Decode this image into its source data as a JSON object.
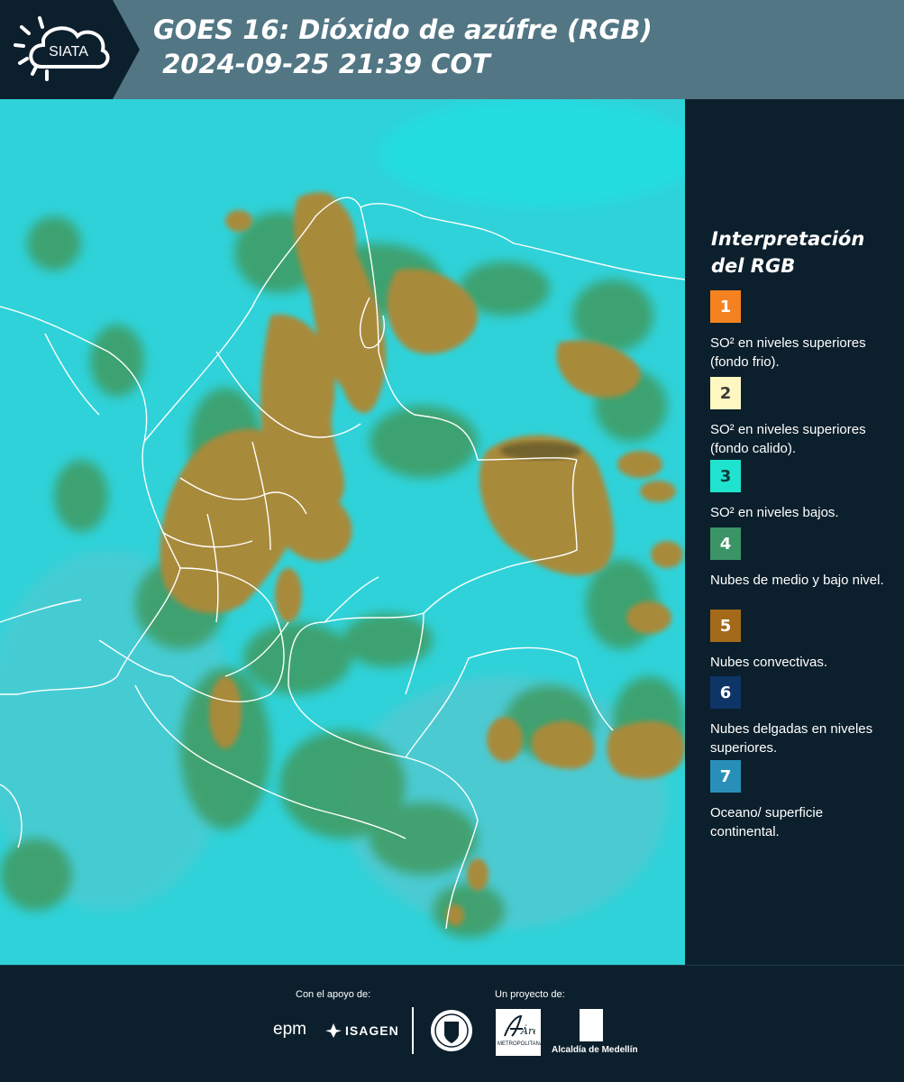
{
  "header": {
    "logo_text": "SIATA",
    "title_line1": "GOES 16: Dióxido de azúfre (RGB)",
    "title_line2": " 2024-09-25 21:39 COT",
    "background_color": "#527684"
  },
  "legend": {
    "title_line1": "Interpretación",
    "title_line2": "del RGB",
    "items": [
      {
        "number": "1",
        "color": "#f58220",
        "text_color": "#ffffff",
        "label": "SO² en niveles superiores (fondo frio)."
      },
      {
        "number": "2",
        "color": "#fff7c2",
        "text_color": "#3a3a3a",
        "label": "SO² en niveles superiores (fondo calido)."
      },
      {
        "number": "3",
        "color": "#1fe3cf",
        "text_color": "#0c3a3a",
        "label": "SO² en niveles bajos."
      },
      {
        "number": "4",
        "color": "#3a9466",
        "text_color": "#ffffff",
        "label": "Nubes de medio y bajo nivel."
      },
      {
        "number": "5",
        "color": "#a36a1a",
        "text_color": "#ffffff",
        "label": "Nubes convectivas."
      },
      {
        "number": "6",
        "color": "#0d3566",
        "text_color": "#ffffff",
        "label": "Nubes delgadas en niveles superiores."
      },
      {
        "number": "7",
        "color": "#2a8fb8",
        "text_color": "#ffffff",
        "label": "Oceano/ superficie continental."
      }
    ]
  },
  "map": {
    "background_color": "#2ed4d8",
    "convective_color": "#a88a3a",
    "midlevel_color": "#3f9a5e",
    "border_color": "#ffffff"
  },
  "footer": {
    "support_label": "Con el apoyo de:",
    "project_label": "Un proyecto de:",
    "sponsor1": "epm",
    "sponsor2": "ISAGEN",
    "area_name": "Área",
    "area_sub": "METROPOLITANA Valle de Aburrá",
    "alcaldia": "Alcaldía de Medellín"
  }
}
